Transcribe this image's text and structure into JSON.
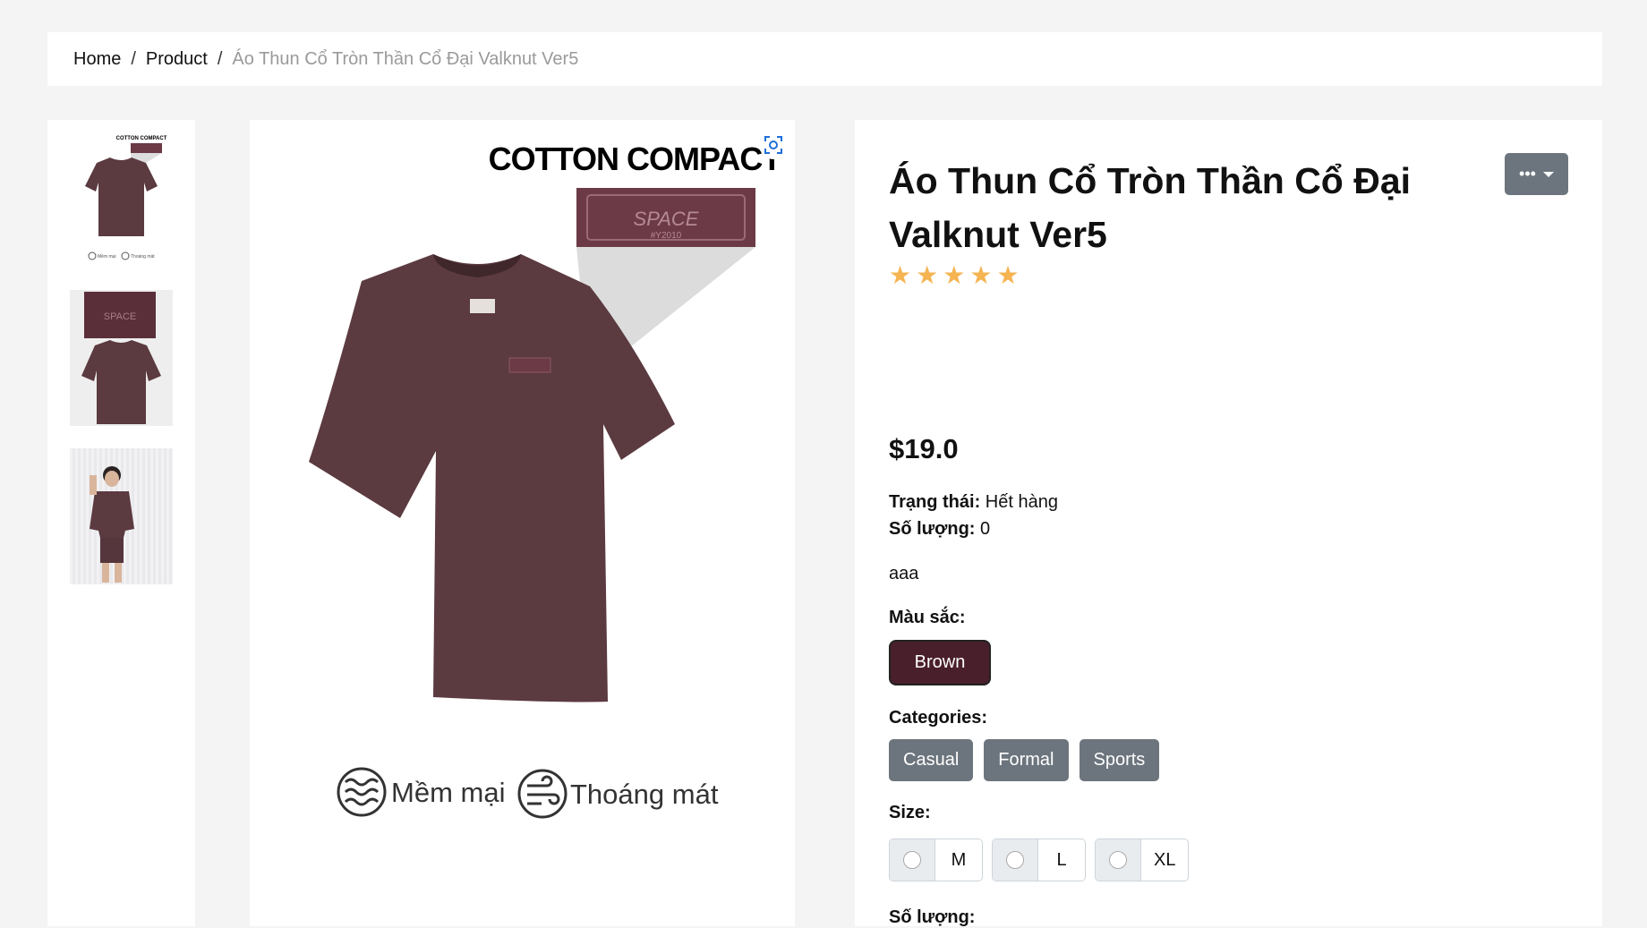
{
  "breadcrumb": {
    "home": "Home",
    "separator": "/",
    "product": "Product",
    "current": "Áo Thun Cổ Tròn Thần Cổ Đại Valknut Ver5"
  },
  "gallery": {
    "thumbnails": [
      {
        "alt": "Brown t-shirt with label closeup"
      },
      {
        "alt": "Label detail and t-shirt"
      },
      {
        "alt": "Model wearing brown outfit"
      }
    ],
    "main_image": {
      "headline": "COTTON COMPACT",
      "label_text": "SPACE",
      "label_subtext": "#Y2010",
      "feature_1": "Mềm mại",
      "feature_2": "Thoáng mát",
      "shirt_color": "#5b3a40"
    },
    "zoom_icon": "focus-zoom-icon"
  },
  "product": {
    "title": "Áo Thun Cổ Tròn Thần Cổ Đại Valknut Ver5",
    "rating": 5,
    "price": "$19.0",
    "status_label": "Trạng thái:",
    "status_value": "Hết hàng",
    "stock_label": "Số lượng:",
    "stock_value": "0",
    "description": "aaa",
    "color_label": "Màu sắc:",
    "color_option": "Brown",
    "color_swatch": "#4a1f2c",
    "categories_label": "Categories:",
    "categories": [
      "Casual",
      "Formal",
      "Sports"
    ],
    "size_label": "Size:",
    "sizes": [
      "M",
      "L",
      "XL"
    ],
    "quantity_label": "Số lượng:",
    "star_color": "#f5b451"
  },
  "colors": {
    "page_bg": "#f4f4f4",
    "secondary_button": "#6c757d"
  }
}
